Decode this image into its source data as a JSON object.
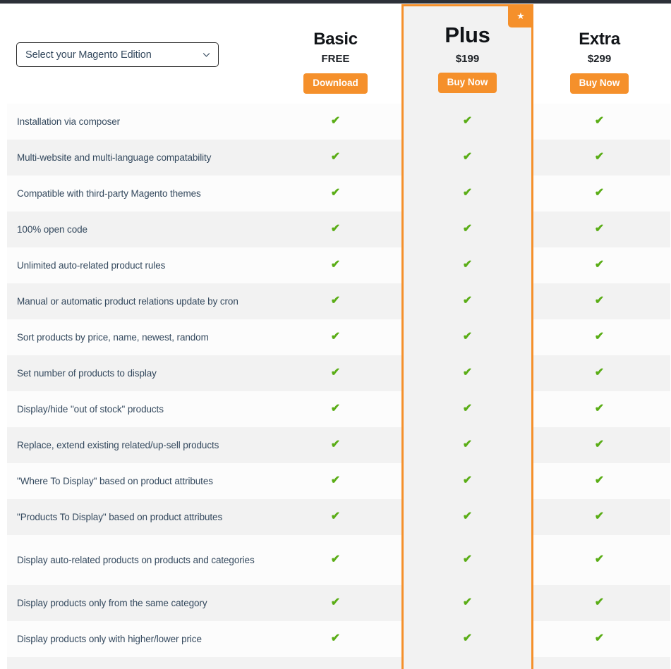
{
  "theme": {
    "accent_orange": "#f5902b",
    "check_green": "#5aad16",
    "text_color": "#34495e",
    "row_light": "#fcfcfc",
    "row_shaded": "#f2f2f2",
    "topbar_color": "#2c3038"
  },
  "edition_select": {
    "value": "Select your Magento Edition",
    "chevron_icon": "chevron-down-icon"
  },
  "plans": [
    {
      "key": "basic",
      "name": "Basic",
      "price": "FREE",
      "cta": "Download",
      "featured": false
    },
    {
      "key": "plus",
      "name": "Plus",
      "price": "$199",
      "cta": "Buy Now",
      "featured": true,
      "badge_icon": "star-icon",
      "badge_glyph": "★"
    },
    {
      "key": "extra",
      "name": "Extra",
      "price": "$299",
      "cta": "Buy Now",
      "featured": false
    }
  ],
  "check_glyph": "✔",
  "features": [
    {
      "label": "Installation via composer",
      "basic": true,
      "plus": true,
      "extra": true
    },
    {
      "label": "Multi-website and multi-language compatability",
      "basic": true,
      "plus": true,
      "extra": true
    },
    {
      "label": "Compatible with third-party Magento themes",
      "basic": true,
      "plus": true,
      "extra": true
    },
    {
      "label": "100% open code",
      "basic": true,
      "plus": true,
      "extra": true
    },
    {
      "label": "Unlimited auto-related product rules",
      "basic": true,
      "plus": true,
      "extra": true
    },
    {
      "label": "Manual or automatic product relations update by cron",
      "basic": true,
      "plus": true,
      "extra": true
    },
    {
      "label": "Sort products by price, name, newest, random",
      "basic": true,
      "plus": true,
      "extra": true
    },
    {
      "label": "Set number of products to display",
      "basic": true,
      "plus": true,
      "extra": true
    },
    {
      "label": "Display/hide \"out of stock\" products",
      "basic": true,
      "plus": true,
      "extra": true
    },
    {
      "label": "Replace, extend existing related/up-sell products",
      "basic": true,
      "plus": true,
      "extra": true
    },
    {
      "label": "\"Where To Display\" based on product attributes",
      "basic": true,
      "plus": true,
      "extra": true
    },
    {
      "label": "\"Products To Display\" based on product attributes",
      "basic": true,
      "plus": true,
      "extra": true
    },
    {
      "label": "Display auto-related products on products and categories",
      "basic": true,
      "plus": true,
      "extra": true,
      "tall": true
    },
    {
      "label": "Display products only from the same category",
      "basic": true,
      "plus": true,
      "extra": true
    },
    {
      "label": "Display products only with higher/lower price",
      "basic": true,
      "plus": true,
      "extra": true
    },
    {
      "label": "",
      "basic": false,
      "plus": false,
      "extra": false,
      "partial": true
    }
  ]
}
